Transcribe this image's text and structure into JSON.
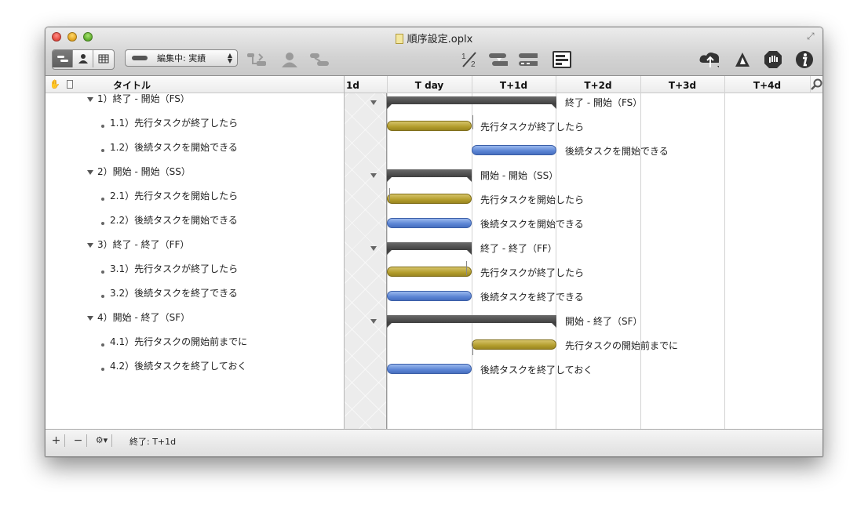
{
  "window": {
    "title": "順序設定.oplx"
  },
  "toolbar": {
    "view_segments": [
      "task-view",
      "resource-view",
      "calendar-view"
    ],
    "mode_popup": "編集中: 実績",
    "tools_left": [
      "add-dependency-icon",
      "add-resource-icon",
      "add-milestone-icon"
    ],
    "tools_center": [
      "fraction-icon",
      "level-icon",
      "catch-up-icon",
      "report-icon"
    ],
    "tools_right": [
      "cloud-publish-icon",
      "triangle-icon",
      "stop-hand-icon",
      "info-icon"
    ]
  },
  "outline": {
    "header_title": "タイトル",
    "rows": [
      {
        "label": "1）終了 - 開始（FS）",
        "level": 0
      },
      {
        "label": "1.1）先行タスクが終了したら",
        "level": 1
      },
      {
        "label": "1.2）後続タスクを開始できる",
        "level": 1
      },
      {
        "label": "2）開始 - 開始（SS）",
        "level": 0
      },
      {
        "label": "2.1）先行タスクを開始したら",
        "level": 1
      },
      {
        "label": "2.2）後続タスクを開始できる",
        "level": 1
      },
      {
        "label": "3）終了 - 終了（FF）",
        "level": 0
      },
      {
        "label": "3.1）先行タスクが終了したら",
        "level": 1
      },
      {
        "label": "3.2）後続タスクを終了できる",
        "level": 1
      },
      {
        "label": "4）開始 - 終了（SF）",
        "level": 0
      },
      {
        "label": "4.1）先行タスクの開始前までに",
        "level": 1
      },
      {
        "label": "4.2）後続タスクを終了しておく",
        "level": 1
      }
    ]
  },
  "gantt": {
    "columns": [
      "1d",
      "T day",
      "T+1d",
      "T+2d",
      "T+3d",
      "T+4d"
    ],
    "bars": [
      {
        "type": "summary",
        "label": "終了 - 開始（FS）",
        "start": 0,
        "end": 2
      },
      {
        "type": "gold",
        "label": "先行タスクが終了したら",
        "start": 0,
        "end": 1
      },
      {
        "type": "blue",
        "label": "後続タスクを開始できる",
        "start": 1,
        "end": 2
      },
      {
        "type": "summary",
        "label": "開始 - 開始（SS）",
        "start": 0,
        "end": 1
      },
      {
        "type": "gold",
        "label": "先行タスクを開始したら",
        "start": 0,
        "end": 1
      },
      {
        "type": "blue",
        "label": "後続タスクを開始できる",
        "start": 0,
        "end": 1
      },
      {
        "type": "summary",
        "label": "終了 - 終了（FF）",
        "start": 0,
        "end": 1
      },
      {
        "type": "gold",
        "label": "先行タスクが終了したら",
        "start": 0,
        "end": 1
      },
      {
        "type": "blue",
        "label": "後続タスクを終了できる",
        "start": 0,
        "end": 1
      },
      {
        "type": "summary",
        "label": "開始 - 終了（SF）",
        "start": 0,
        "end": 2
      },
      {
        "type": "gold",
        "label": "先行タスクの開始前までに",
        "start": 1,
        "end": 2
      },
      {
        "type": "blue",
        "label": "後続タスクを終了しておく",
        "start": 0,
        "end": 1
      }
    ]
  },
  "statusbar": {
    "add_label": "+",
    "remove_label": "−",
    "gear_label": "⚙▾",
    "info": "終了: T+1d"
  },
  "colors": {
    "gold": "#b39d2d",
    "blue": "#5b84d4",
    "summary": "#444444"
  }
}
